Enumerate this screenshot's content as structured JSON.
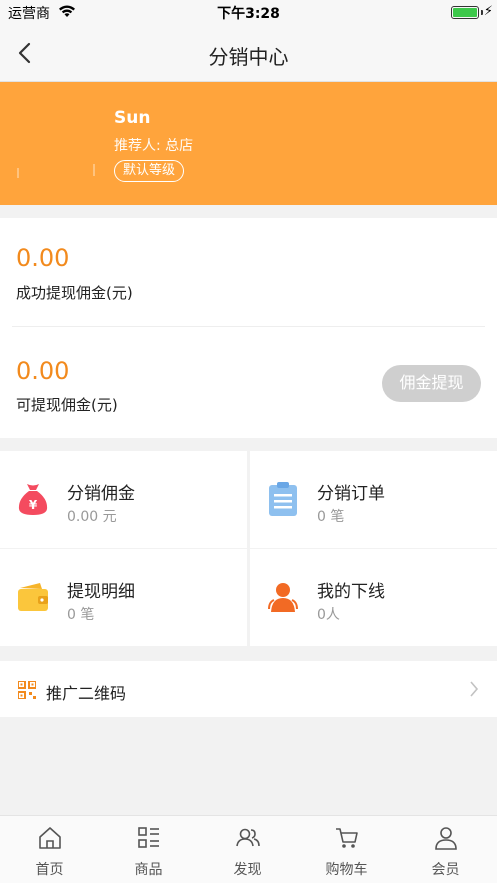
{
  "status_bar": {
    "carrier": "运营商",
    "time": "下午3:28",
    "battery_level": 1.0
  },
  "nav": {
    "title": "分销中心",
    "back_icon": "chevron-left-icon"
  },
  "profile": {
    "name": "Sun",
    "referrer": "推荐人: 总店",
    "level": "默认等级",
    "background_color": "#ffa43c"
  },
  "commission": {
    "withdrawn_amount": "0.00",
    "withdrawn_label": "成功提现佣金(元)",
    "available_amount": "0.00",
    "available_label": "可提现佣金(元)",
    "withdraw_button": "佣金提现",
    "amount_color": "#f28a1d"
  },
  "grid": [
    {
      "title": "分销佣金",
      "sub": "0.00 元",
      "icon": "money-bag-icon"
    },
    {
      "title": "分销订单",
      "sub": "0 笔",
      "icon": "clipboard-icon"
    },
    {
      "title": "提现明细",
      "sub": "0 笔",
      "icon": "wallet-icon"
    },
    {
      "title": "我的下线",
      "sub": "0人",
      "icon": "team-icon"
    }
  ],
  "qr": {
    "label": "推广二维码",
    "icon": "qr-code-icon"
  },
  "tabs": [
    {
      "label": "首页",
      "icon": "home-icon"
    },
    {
      "label": "商品",
      "icon": "list-icon"
    },
    {
      "label": "发现",
      "icon": "people-icon"
    },
    {
      "label": "购物车",
      "icon": "cart-icon"
    },
    {
      "label": "会员",
      "icon": "user-icon"
    }
  ]
}
